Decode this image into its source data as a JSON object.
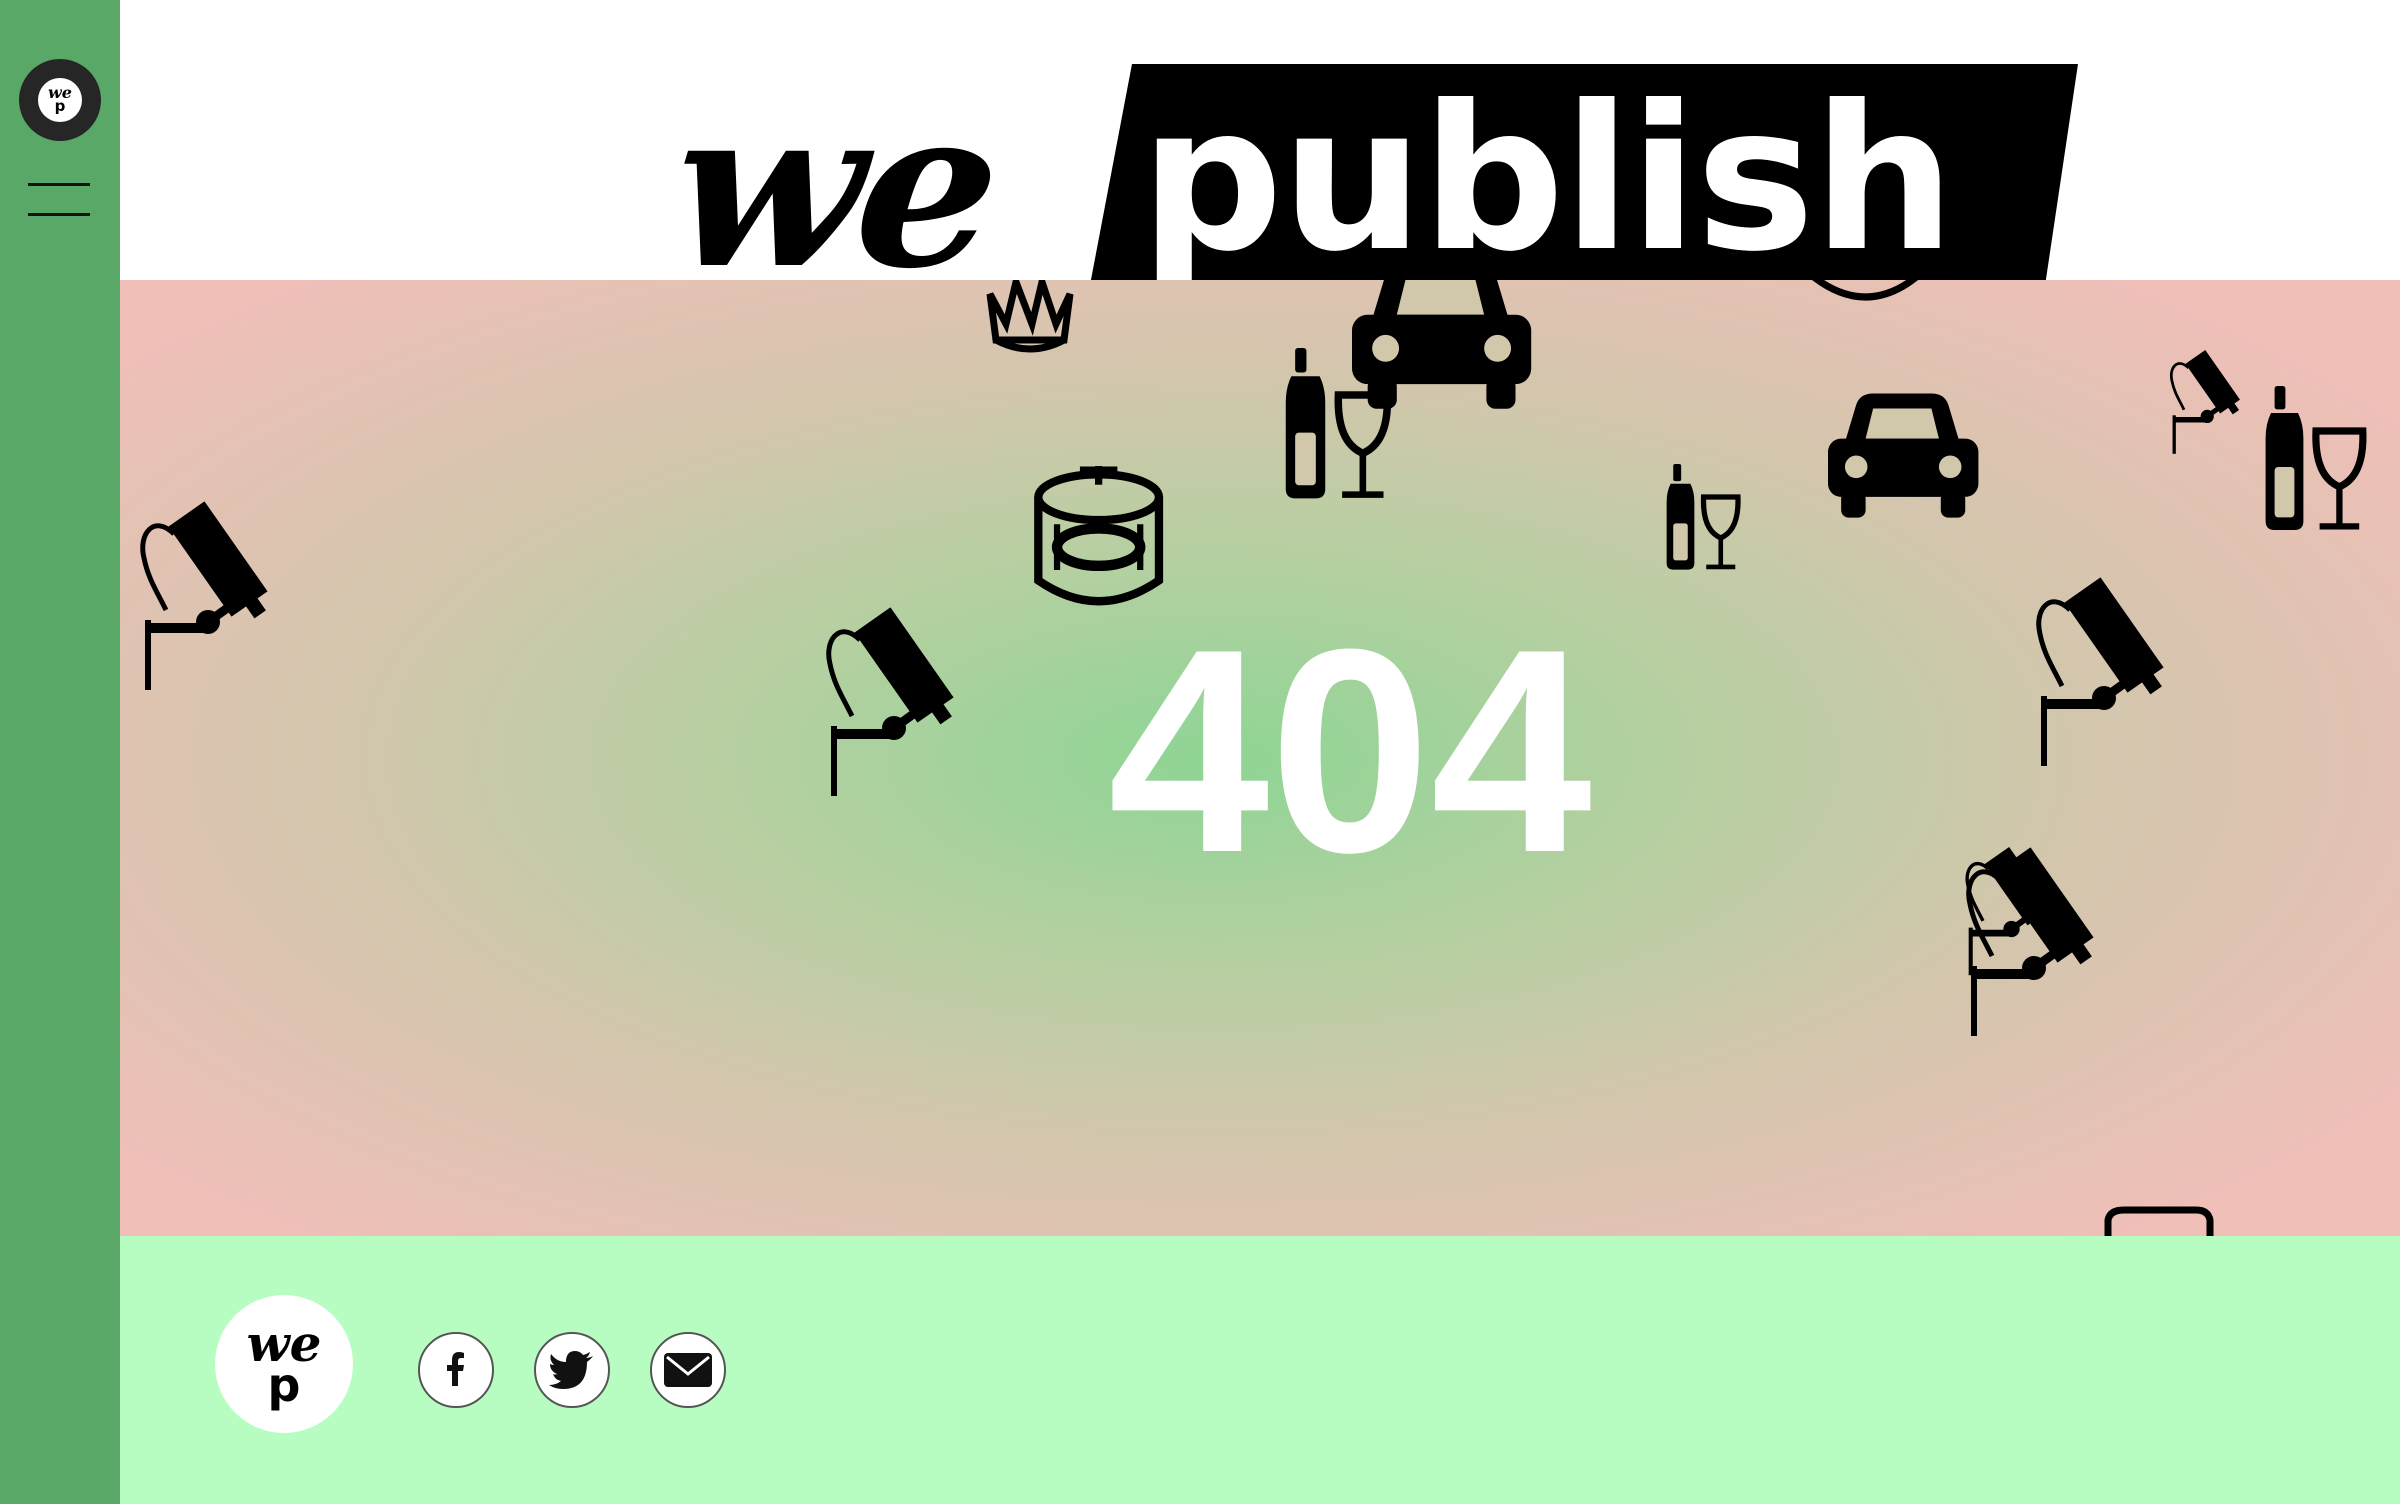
{
  "brand": {
    "logo_we": "we",
    "logo_p": "p",
    "wordmark_we": "we",
    "wordmark_publish": "publish"
  },
  "navigation": {
    "menu_icon": "hamburger-icon"
  },
  "hero": {
    "error_code": "404",
    "pattern_icons": [
      "surveillance-camera-icon",
      "car-icon",
      "wine-bottle-glass-icon",
      "crown-icon",
      "stadium-icon"
    ]
  },
  "footer": {
    "logo_we": "we",
    "logo_p": "p",
    "social": [
      {
        "icon": "facebook-icon"
      },
      {
        "icon": "twitter-icon"
      },
      {
        "icon": "mail-icon"
      }
    ]
  },
  "colors": {
    "sidebar": "#5aa867",
    "footer": "#b7fcc1",
    "hero_center": "#8ed595",
    "hero_edge": "#efbfb8",
    "text_on_hero": "#ffffff"
  }
}
